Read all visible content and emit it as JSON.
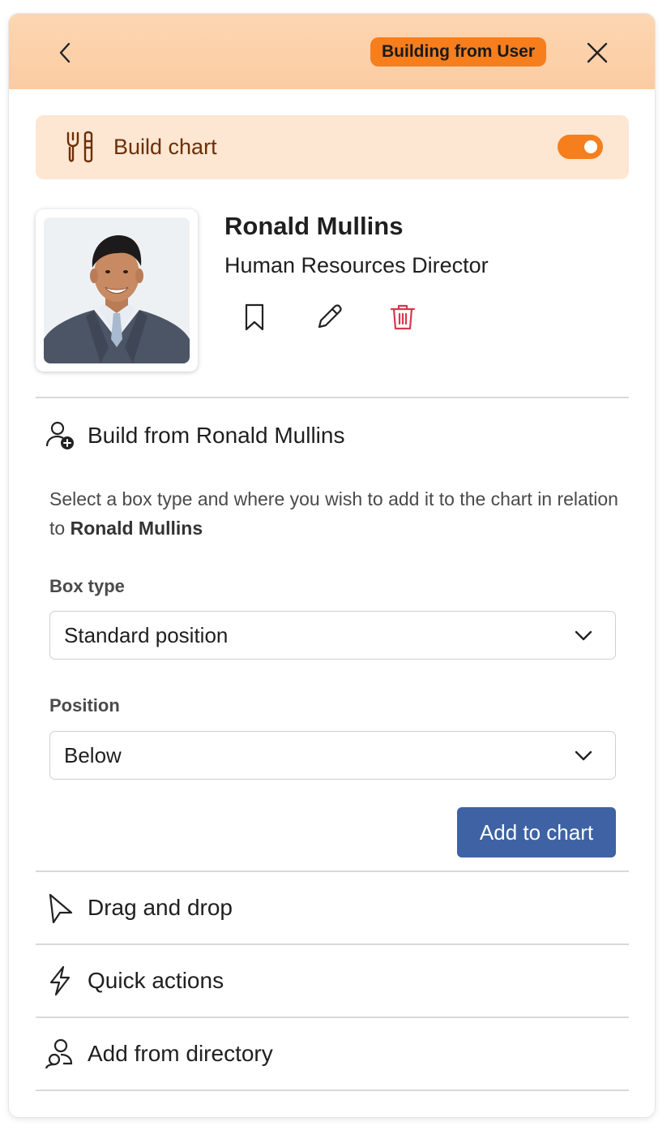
{
  "header": {
    "mode_badge": "Building from User"
  },
  "build_banner": {
    "title": "Build chart",
    "toggle_on": true
  },
  "person": {
    "name": "Ronald Mullins",
    "job_title": "Human Resources Director"
  },
  "build_section": {
    "title": "Build from Ronald Mullins",
    "description_prefix": "Select a box type and where you wish to add it to the chart in relation to ",
    "description_name": "Ronald Mullins",
    "box_type_label": "Box type",
    "box_type_value": "Standard position",
    "position_label": "Position",
    "position_value": "Below",
    "add_button": "Add to chart"
  },
  "sections": [
    {
      "label": "Drag and drop",
      "icon": "pointer-icon"
    },
    {
      "label": "Quick actions",
      "icon": "lightning-icon"
    },
    {
      "label": "Add from directory",
      "icon": "people-icon"
    }
  ],
  "colors": {
    "header_bg": "#fcd1aa",
    "accent_orange": "#f67e1d",
    "banner_bg": "#fde6d2",
    "banner_text": "#6b2f06",
    "primary_button": "#3e62a4",
    "delete_red": "#d43a4e"
  }
}
